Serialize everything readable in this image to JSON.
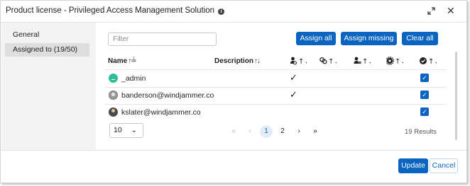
{
  "dialog": {
    "title": "Product license - Privileged Access Management Solution",
    "info_icon": "info-icon",
    "expand_icon": "expand-icon",
    "close_icon": "close-icon"
  },
  "sidebar": {
    "items": [
      {
        "label": "General",
        "active": false
      },
      {
        "label": "Assigned to (19/50)",
        "active": true
      }
    ]
  },
  "toolbar": {
    "filter_placeholder": "Filter",
    "filter_value": "",
    "assign_all": "Assign all",
    "assign_missing": "Assign missing",
    "clear_all": "Clear all"
  },
  "table": {
    "columns": [
      {
        "label": "Name",
        "sort": "sort-asc-icon"
      },
      {
        "label": "Description",
        "sort": "sort-icon"
      },
      {
        "icon": "user-key-icon",
        "sort": "sort-icon"
      },
      {
        "icon": "link-icon",
        "sort": "sort-icon"
      },
      {
        "icon": "user-x-icon",
        "sort": "sort-icon"
      },
      {
        "icon": "gear-icon",
        "sort": "sort-icon"
      },
      {
        "icon": "check-circle-icon",
        "sort": "sort-icon"
      }
    ],
    "rows": [
      {
        "name": "_admin",
        "description": "",
        "col3_checked": true,
        "assigned": true,
        "avatar": "teal-avatar"
      },
      {
        "name": "banderson@windjammer.co",
        "description": "",
        "col3_checked": true,
        "assigned": true,
        "avatar": "photo-avatar"
      },
      {
        "name": "kslater@windjammer.co",
        "description": "",
        "col3_checked": false,
        "assigned": true,
        "avatar": "photo-avatar"
      }
    ],
    "check_glyph": "✓"
  },
  "pagination": {
    "page_size": "10",
    "first": "«",
    "prev": "‹",
    "pages": [
      "1",
      "2"
    ],
    "current": "1",
    "next": "›",
    "last": "»",
    "results": "19 Results"
  },
  "footer": {
    "update": "Update",
    "cancel": "Cancel"
  },
  "colors": {
    "accent": "#0b64c0",
    "sidebar_bg": "#f3f3f3",
    "sidebar_active": "#dedede"
  }
}
